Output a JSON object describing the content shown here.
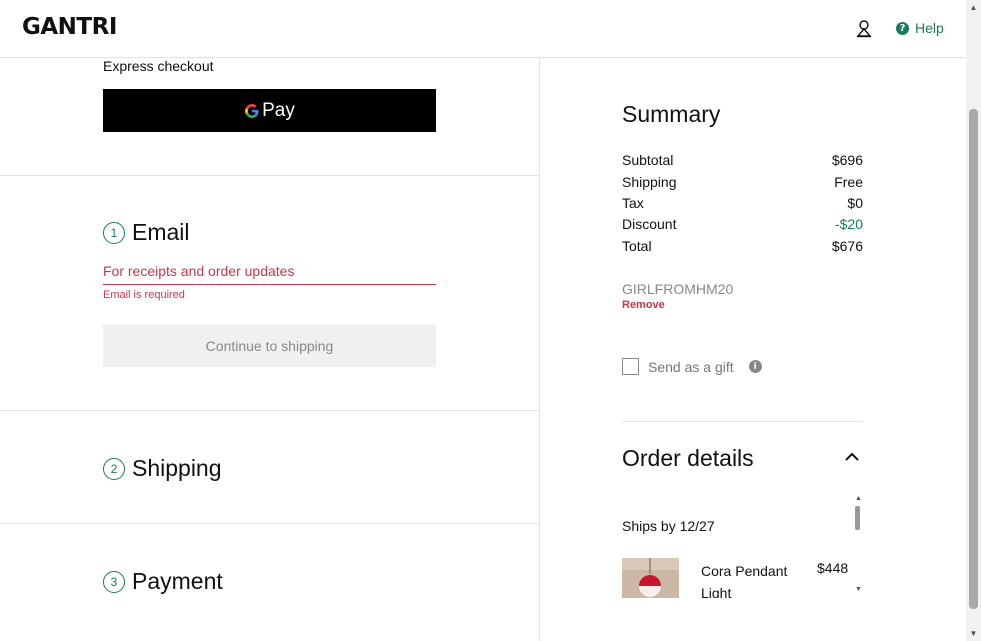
{
  "header": {
    "logo": "GANTRI",
    "help_label": "Help",
    "icons": {
      "account": "user-icon",
      "help": "question-circle-icon"
    }
  },
  "checkout": {
    "express_label": "Express checkout",
    "gpay_label": "Pay",
    "steps": [
      {
        "num": "1",
        "title": "Email"
      },
      {
        "num": "2",
        "title": "Shipping"
      },
      {
        "num": "3",
        "title": "Payment"
      }
    ],
    "email": {
      "value": "",
      "placeholder": "For receipts and order updates",
      "error": "Email is required"
    },
    "continue_label": "Continue to shipping"
  },
  "summary": {
    "title": "Summary",
    "rows": [
      {
        "label": "Subtotal",
        "value": "$696"
      },
      {
        "label": "Shipping",
        "value": "Free"
      },
      {
        "label": "Tax",
        "value": "$0"
      },
      {
        "label": "Discount",
        "value": "-$20"
      },
      {
        "label": "Total",
        "value": "$676"
      }
    ],
    "promo_code": "GIRLFROMHM20",
    "promo_remove": "Remove",
    "gift_label": "Send as a gift",
    "gift_checked": false
  },
  "order_details": {
    "title": "Order details",
    "ships_by": "Ships by 12/27",
    "items": [
      {
        "name": "Cora Pendant Light",
        "price": "$448"
      }
    ]
  },
  "colors": {
    "accent_green": "#1a7a5b",
    "error_red": "#c0394b",
    "gpay_black": "#000000"
  }
}
